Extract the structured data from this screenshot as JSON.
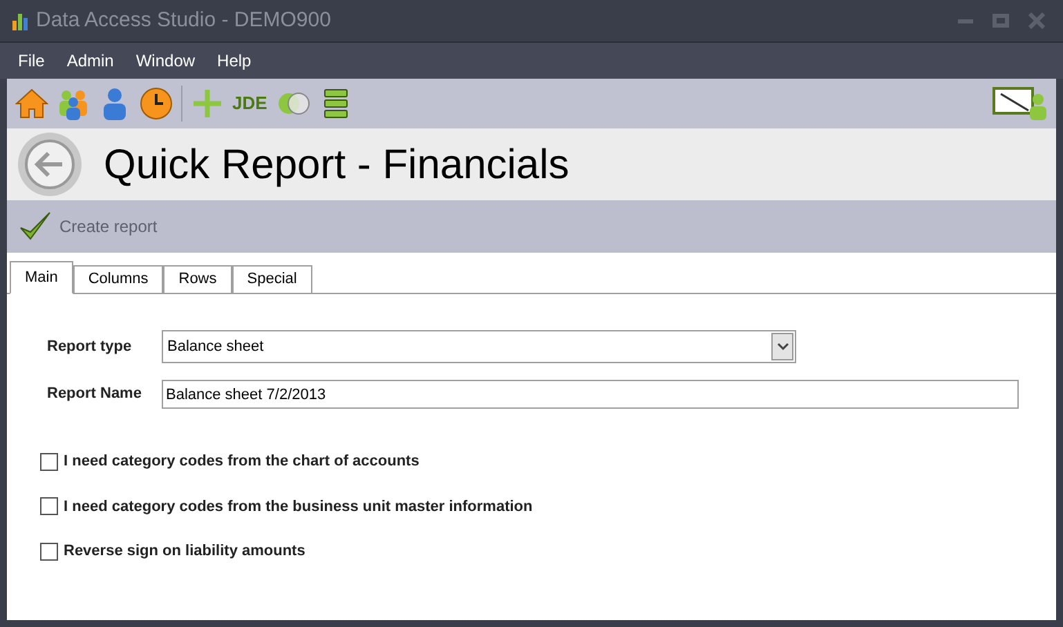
{
  "window": {
    "title": "Data Access Studio - DEMO900"
  },
  "menu": [
    "File",
    "Admin",
    "Window",
    "Help"
  ],
  "toolbar": {
    "jde_label": "JDE"
  },
  "header": {
    "title": "Quick Report - Financials"
  },
  "actions": [
    {
      "label": "Create report",
      "disabled": true
    }
  ],
  "tabs": [
    {
      "label": "Main",
      "selected": true
    },
    {
      "label": "Columns",
      "selected": false
    },
    {
      "label": "Rows",
      "selected": false
    },
    {
      "label": "Special",
      "selected": false
    }
  ],
  "form": {
    "report_type": {
      "label": "Report type",
      "value": "Balance sheet"
    },
    "report_name": {
      "label": "Report Name",
      "value": "Balance sheet 7/2/2013"
    }
  },
  "options": [
    {
      "label": "I need category codes from the chart of accounts",
      "checked": false
    },
    {
      "label": "I need category codes from the business unit master information",
      "checked": false
    },
    {
      "label": "Reverse sign on liability amounts",
      "checked": false
    }
  ]
}
